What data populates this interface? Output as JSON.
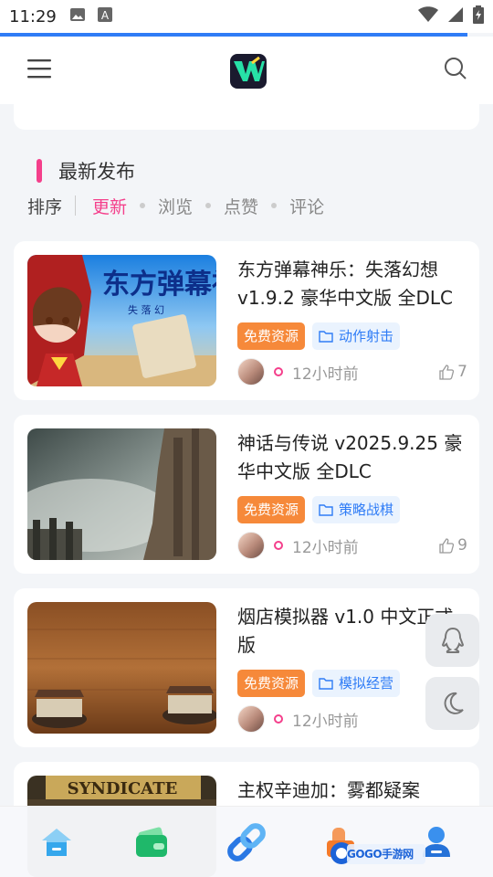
{
  "status_bar": {
    "time": "11:29",
    "icons": [
      "image-icon",
      "a-icon",
      "wifi-icon",
      "signal-icon",
      "battery-icon"
    ]
  },
  "colors": {
    "accent_pink": "#f43f8b",
    "accent_blue": "#2f7cf6",
    "free_tag_orange": "#f6893a"
  },
  "header": {
    "menu_icon": "menu-icon",
    "logo_icon": "app-logo-icon",
    "search_icon": "search-icon"
  },
  "section": {
    "title": "最新发布",
    "sort_label": "排序",
    "sort_options": [
      "更新",
      "浏览",
      "点赞",
      "评论"
    ],
    "active_sort": "更新"
  },
  "posts": [
    {
      "title": "东方弹幕神乐：失落幻想 v1.9.2 豪华中文版 全DLC",
      "tag_free": "免费资源",
      "category": "动作射击",
      "time": "12小时前",
      "likes": "7"
    },
    {
      "title": "神话与传说 v2025.9.25 豪华中文版 全DLC",
      "tag_free": "免费资源",
      "category": "策略战棋",
      "time": "12小时前",
      "likes": "9"
    },
    {
      "title": "烟店模拟器 v1.0 中文正式版",
      "tag_free": "免费资源",
      "category": "模拟经营",
      "time": "12小时前",
      "likes": ""
    },
    {
      "title": "主权辛迪加：雾都疑案",
      "tag_free": "",
      "category": "",
      "time": "",
      "likes": ""
    }
  ],
  "thumb_text": {
    "post0_big": "东方弹幕神",
    "post0_sub": "失  落  幻",
    "post3_logo": "SYNDICATE"
  },
  "floating": {
    "qq_icon": "qq-penguin-icon",
    "night_icon": "moon-icon"
  },
  "bottom_nav": {
    "items": [
      "home-icon",
      "wallet-icon",
      "link-icon",
      "cart-icon",
      "user-icon"
    ]
  },
  "watermark": {
    "text": "GOGO手游网"
  }
}
